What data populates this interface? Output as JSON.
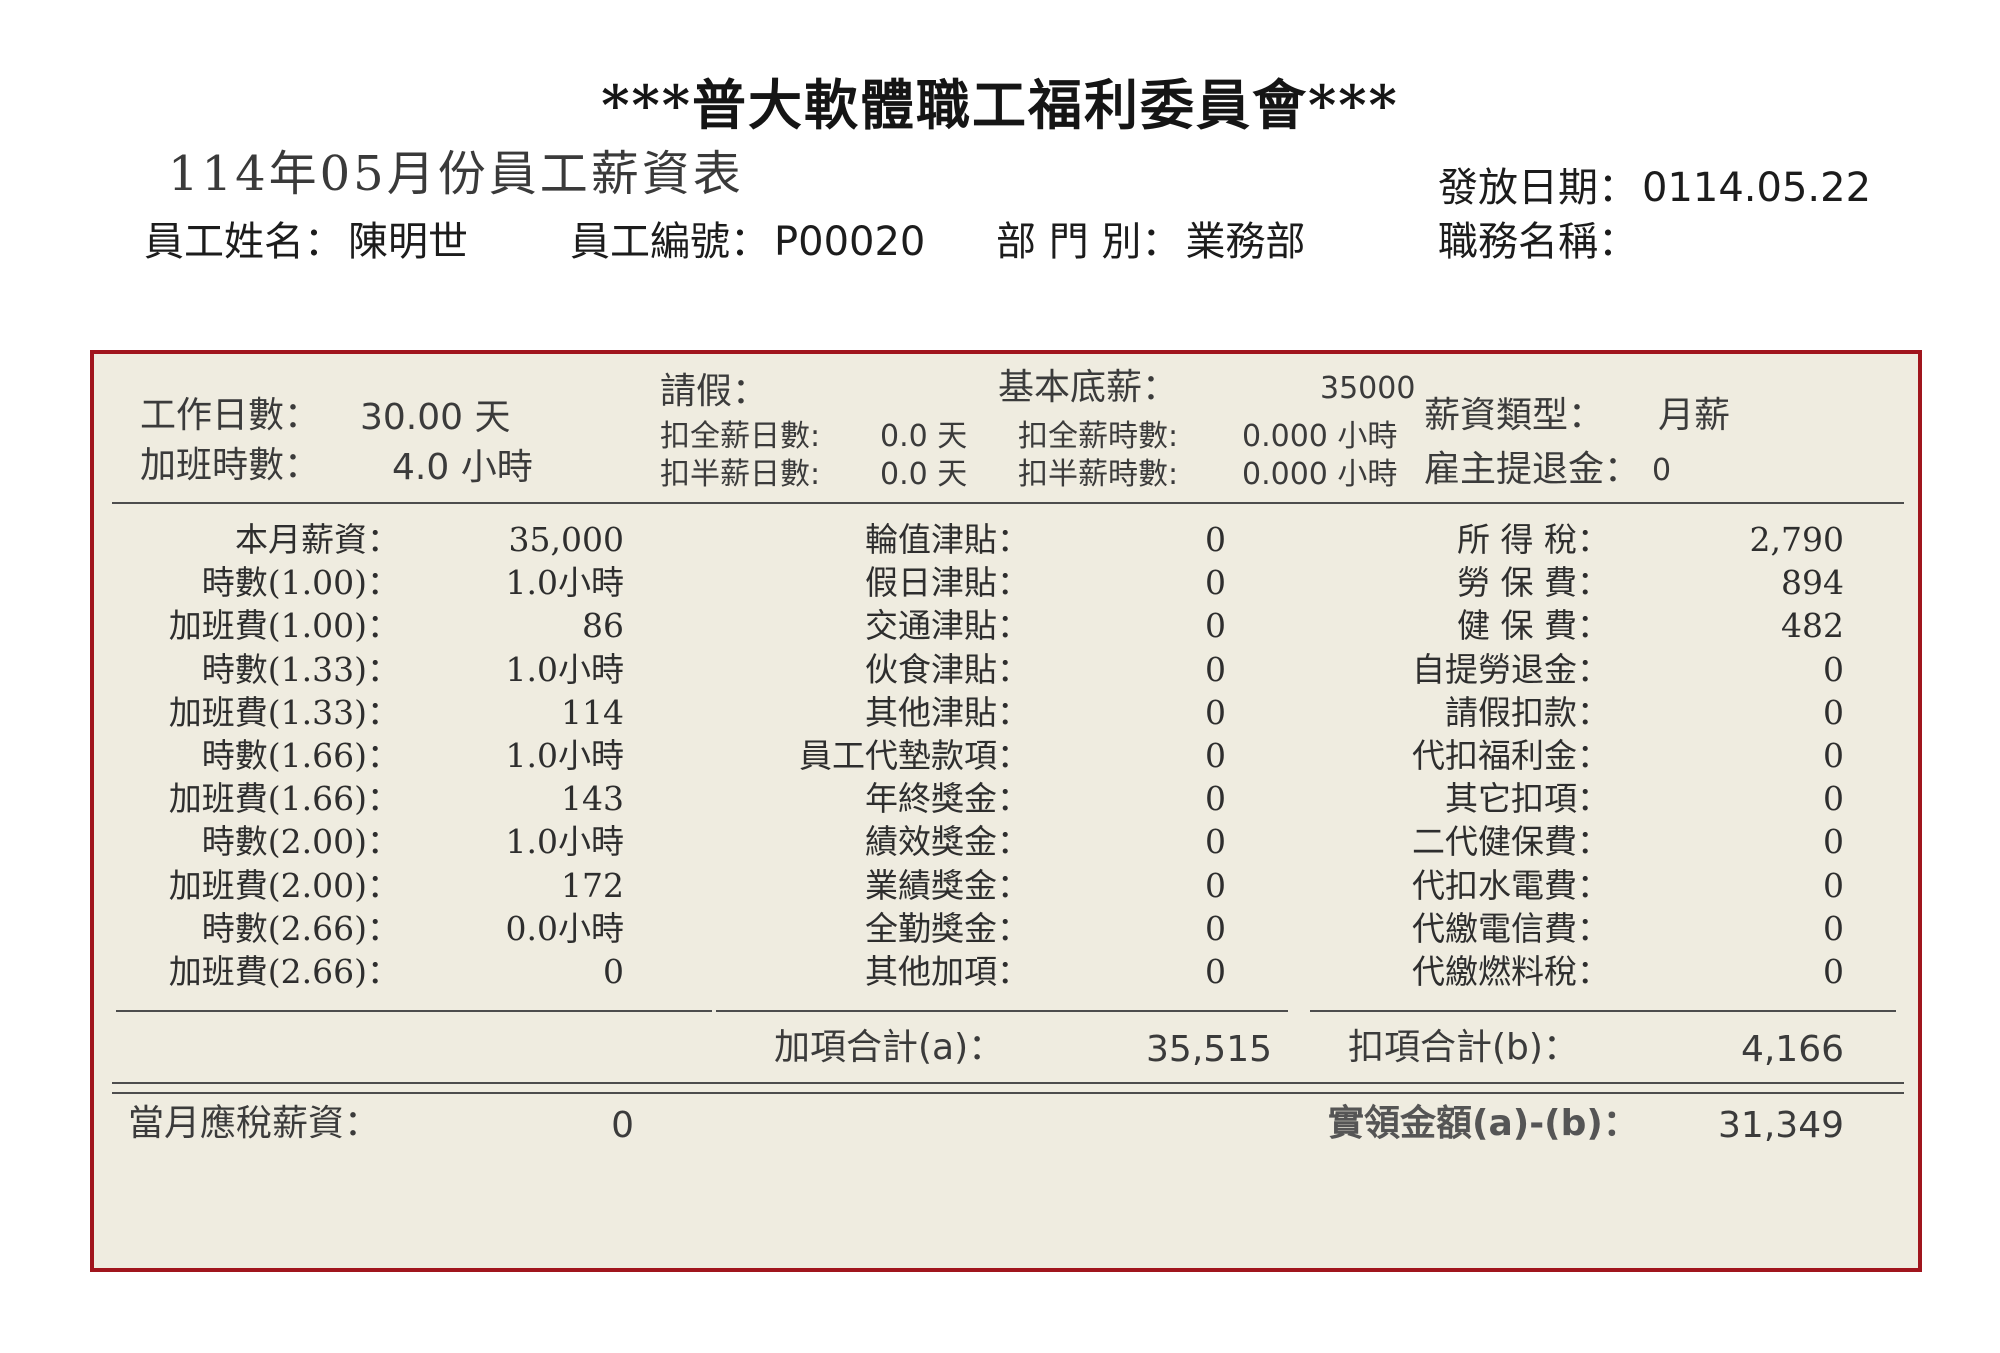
{
  "title": "***普大軟體職工福利委員會***",
  "subtitle": "114年05月份員工薪資表",
  "header": {
    "issue_date_label": "發放日期：",
    "issue_date": "0114.05.22",
    "name_label": "員工姓名：",
    "name": "陳明世",
    "id_label": "員工編號：",
    "id": "P00020",
    "dept_label": "部 門 別：",
    "dept": "業務部",
    "title_label": "職務名稱：",
    "job_title": ""
  },
  "summary": {
    "work_days_label": "工作日數：",
    "work_days": "30.00 天",
    "ot_hours_label": "加班時數：",
    "ot_hours": "4.0 小時",
    "leave_label": "請假：",
    "full_deduct_days_label": "扣全薪日數:",
    "full_deduct_days": "0.0 天",
    "half_deduct_days_label": "扣半薪日數:",
    "half_deduct_days": "0.0 天",
    "base_salary_label": "基本底薪：",
    "base_salary": "35000",
    "full_deduct_hours_label": "扣全薪時數:",
    "full_deduct_hours": "0.000 小時",
    "half_deduct_hours_label": "扣半薪時數:",
    "half_deduct_hours": "0.000 小時",
    "salary_type_label": "薪資類型：",
    "salary_type": "月薪",
    "pension_label": "雇主提退金：",
    "pension": "0"
  },
  "left_items": [
    {
      "label": "本月薪資：",
      "value": "35,000"
    },
    {
      "label": "時數(1.00)：",
      "value": "1.0小時"
    },
    {
      "label": "加班費(1.00)：",
      "value": "86"
    },
    {
      "label": "時數(1.33)：",
      "value": "1.0小時"
    },
    {
      "label": "加班費(1.33)：",
      "value": "114"
    },
    {
      "label": "時數(1.66)：",
      "value": "1.0小時"
    },
    {
      "label": "加班費(1.66)：",
      "value": "143"
    },
    {
      "label": "時數(2.00)：",
      "value": "1.0小時"
    },
    {
      "label": "加班費(2.00)：",
      "value": "172"
    },
    {
      "label": "時數(2.66)：",
      "value": "0.0小時"
    },
    {
      "label": "加班費(2.66)：",
      "value": "0"
    }
  ],
  "mid_items": [
    {
      "label": "輪值津貼：",
      "value": "0"
    },
    {
      "label": "假日津貼：",
      "value": "0"
    },
    {
      "label": "交通津貼：",
      "value": "0"
    },
    {
      "label": "伙食津貼：",
      "value": "0"
    },
    {
      "label": "其他津貼：",
      "value": "0"
    },
    {
      "label": "員工代墊款項：",
      "value": "0"
    },
    {
      "label": "年終獎金：",
      "value": "0"
    },
    {
      "label": "績效獎金：",
      "value": "0"
    },
    {
      "label": "業績獎金：",
      "value": "0"
    },
    {
      "label": "全勤獎金：",
      "value": "0"
    },
    {
      "label": "其他加項：",
      "value": "0"
    }
  ],
  "right_items": [
    {
      "label": "所 得 稅：",
      "value": "2,790"
    },
    {
      "label": "勞 保 費：",
      "value": "894"
    },
    {
      "label": "健 保 費：",
      "value": "482"
    },
    {
      "label": "自提勞退金：",
      "value": "0"
    },
    {
      "label": "請假扣款：",
      "value": "0"
    },
    {
      "label": "代扣福利金：",
      "value": "0"
    },
    {
      "label": "其它扣項：",
      "value": "0"
    },
    {
      "label": "二代健保費：",
      "value": "0"
    },
    {
      "label": "代扣水電費：",
      "value": "0"
    },
    {
      "label": "代繳電信費：",
      "value": "0"
    },
    {
      "label": "代繳燃料稅：",
      "value": "0"
    }
  ],
  "totals": {
    "add_label": "加項合計(a)：",
    "add_value": "35,515",
    "deduct_label": "扣項合計(b)：",
    "deduct_value": "4,166"
  },
  "bottom": {
    "taxable_label": "當月應稅薪資：",
    "taxable_value": "0",
    "net_label": "實領金額(a)-(b)：",
    "net_value": "31,349"
  }
}
